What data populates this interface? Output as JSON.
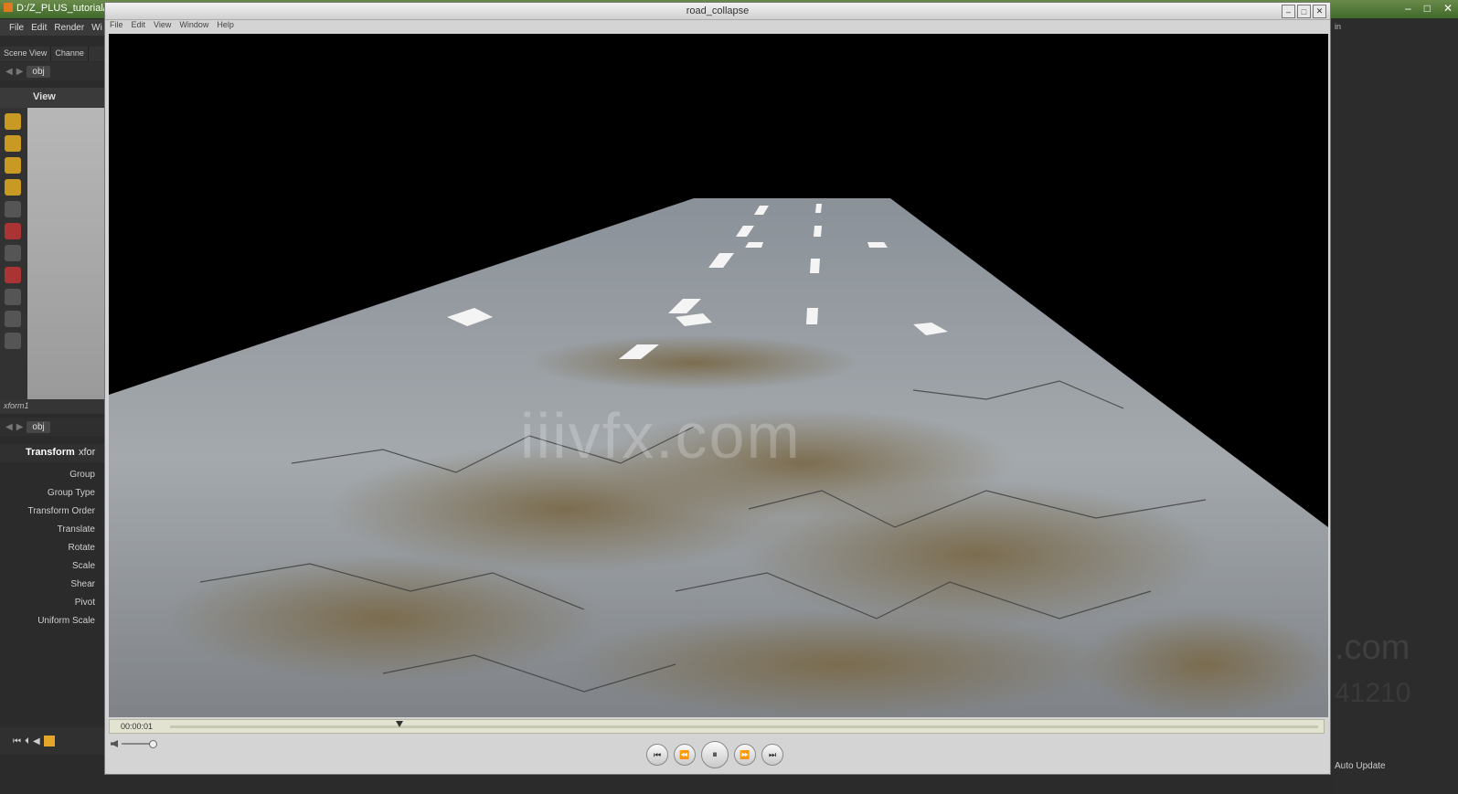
{
  "host": {
    "title": "D:/Z_PLUS_tutorial/ro",
    "menu": [
      "File",
      "Edit",
      "Render",
      "Wi"
    ],
    "pane_tabs": [
      "Scene View",
      "Channe"
    ],
    "path": "obj",
    "view_label": "View",
    "param_pane_label": "xform1",
    "node_type": "Transform",
    "node_name": "xfor",
    "params": [
      "Group",
      "Group Type",
      "Transform Order",
      "Translate",
      "Rotate",
      "Scale",
      "Shear",
      "Pivot",
      "Uniform Scale"
    ],
    "right_label": "in",
    "auto_update": "Auto Update",
    "watermark_a": ".com",
    "watermark_b": "41210"
  },
  "flipbook": {
    "title": "road_collapse",
    "menu": [
      "File",
      "Edit",
      "View",
      "Window",
      "Help"
    ],
    "timecode": "00:00:01",
    "watermark": "iiivfx.com",
    "playhead_fraction": 0.2
  }
}
